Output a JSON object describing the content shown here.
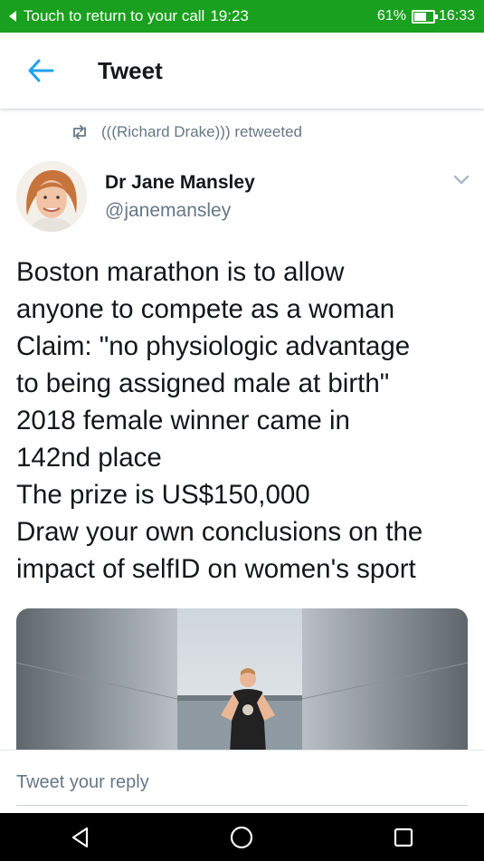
{
  "status_bar": {
    "call_text": "Touch to return to your call",
    "call_time": "19:23",
    "battery": "61%",
    "clock": "16:33",
    "bg_color": "#1aa01f"
  },
  "header": {
    "title": "Tweet",
    "back_icon": "arrow-left-icon"
  },
  "retweet": {
    "text": "(((Richard Drake))) retweeted",
    "icon": "retweet-icon"
  },
  "author": {
    "name": "Dr Jane Mansley",
    "handle": "@janemansley"
  },
  "tweet": {
    "lines": [
      "Boston marathon is to allow",
      "anyone to compete as a woman",
      "Claim: \"no physiologic advantage",
      "to being assigned male at birth\"",
      "2018 female winner came in",
      "142nd place",
      "The prize is US$150,000",
      "Draw your own conclusions on the",
      "impact of selfID on women's sport"
    ]
  },
  "reply": {
    "placeholder": "Tweet your reply"
  },
  "colors": {
    "accent": "#1da1f2",
    "muted": "#657786"
  }
}
